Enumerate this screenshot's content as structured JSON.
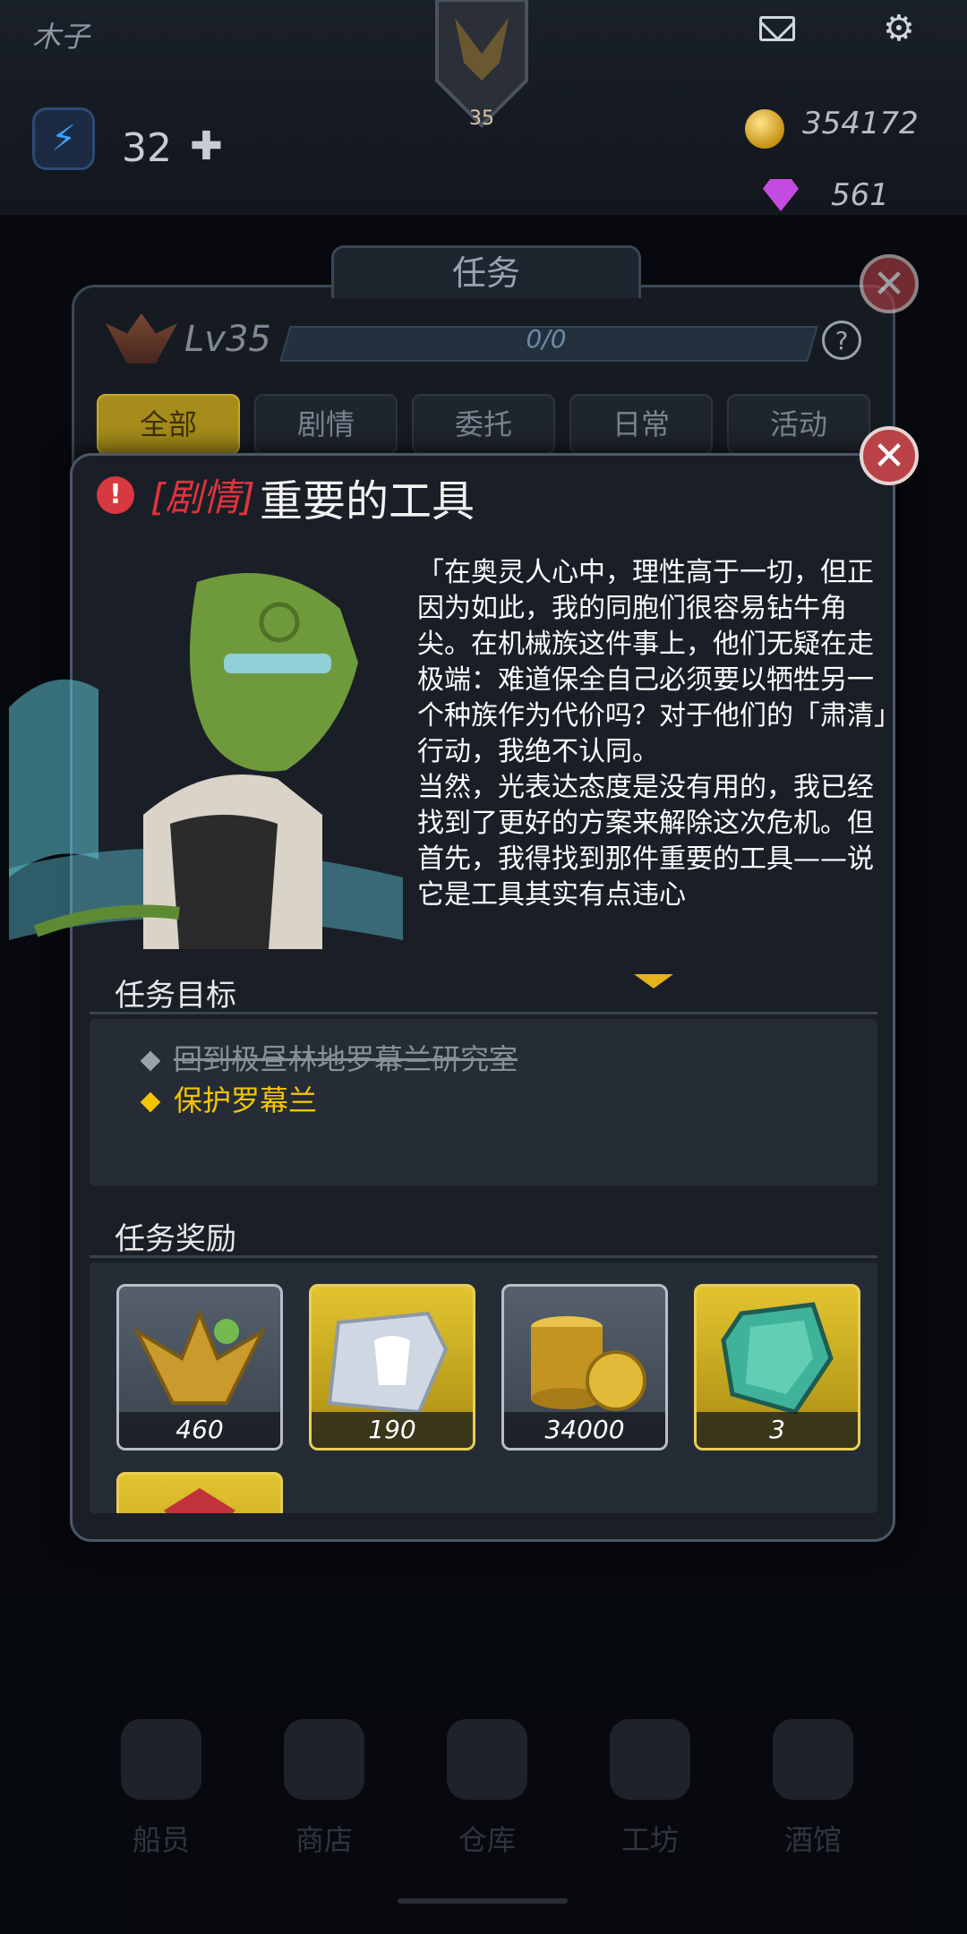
{
  "hud": {
    "player_name": "木子",
    "rank_level": "35",
    "energy": "32",
    "coins": "354172",
    "gems": "561",
    "icons": [
      "mail-icon",
      "gear-icon",
      "energy-icon",
      "coin-icon",
      "gem-icon"
    ]
  },
  "board": {
    "title": "任务",
    "level": "Lv35",
    "exp_text": "0/0",
    "exp_fraction": 0,
    "help": "?",
    "tabs": [
      "全部",
      "剧情",
      "委托",
      "日常",
      "活动"
    ],
    "active_tab": 0
  },
  "popup": {
    "close": "✕",
    "category": "[剧情]",
    "title": "重要的工具",
    "story": "「在奥灵人心中，理性高于一切，但正因为如此，我的同胞们很容易钻牛角尖。在机械族这件事上，他们无疑在走极端：难道保全自己必须要以牺牲另一个种族作为代价吗？对于他们的「肃清」行动，我绝不认同。\n当然，光表达态度是没有用的，我已经找到了更好的方案来解除这次危机。但首先，我得找到那件重要的工具——说它是工具其实有点违心",
    "objectives_title": "任务目标",
    "objectives": [
      {
        "text": "回到极昼林地罗幕兰研究室",
        "done": true
      },
      {
        "text": "保护罗幕兰",
        "done": false
      }
    ],
    "rewards_title": "任务奖励",
    "rewards": [
      {
        "qty": "460",
        "icon": "rank-exp-icon",
        "rarity": "common"
      },
      {
        "qty": "190",
        "icon": "armor-fragment-icon",
        "rarity": "gold"
      },
      {
        "qty": "34000",
        "icon": "coins-icon",
        "rarity": "common"
      },
      {
        "qty": "3",
        "icon": "crystal-icon",
        "rarity": "gold"
      },
      {
        "qty": "",
        "icon": "red-item-icon",
        "rarity": "gold"
      }
    ]
  },
  "nav": [
    {
      "label": "船员",
      "icon": "crew-icon"
    },
    {
      "label": "商店",
      "icon": "shop-icon"
    },
    {
      "label": "仓库",
      "icon": "warehouse-icon"
    },
    {
      "label": "工坊",
      "icon": "workshop-icon"
    },
    {
      "label": "酒馆",
      "icon": "tavern-icon"
    }
  ],
  "colors": {
    "accent_gold": "#f3c500",
    "category_red": "#e0343c",
    "close_red": "#b94247"
  }
}
